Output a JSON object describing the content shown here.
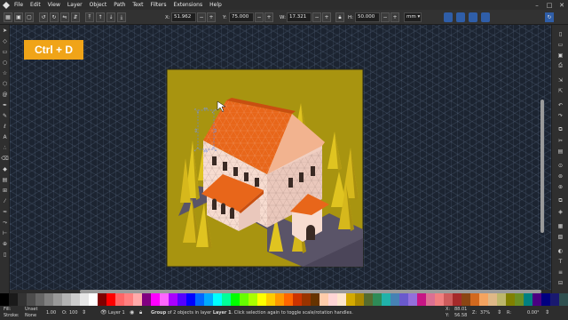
{
  "menu": [
    "File",
    "Edit",
    "View",
    "Layer",
    "Object",
    "Path",
    "Text",
    "Filters",
    "Extensions",
    "Help"
  ],
  "toolcontrols": {
    "x_label": "X:",
    "x_value": "51.962",
    "y_label": "Y:",
    "y_value": "75.000",
    "w_label": "W:",
    "w_value": "17.321",
    "h_label": "H:",
    "h_value": "50.000",
    "unit": "mm",
    "minus": "−",
    "plus": "+"
  },
  "shortcut_label": "Ctrl + D",
  "palette": [
    "#000000",
    "#1a1a1a",
    "#333333",
    "#4d4d4d",
    "#666666",
    "#808080",
    "#999999",
    "#b3b3b3",
    "#cccccc",
    "#e6e6e6",
    "#ffffff",
    "#800000",
    "#ff0000",
    "#ff6666",
    "#ff8080",
    "#ffaaaa",
    "#800080",
    "#ff00ff",
    "#ff66ff",
    "#aa00ff",
    "#5500ff",
    "#0000ff",
    "#0066ff",
    "#00aaff",
    "#00ffff",
    "#00ff99",
    "#00ff00",
    "#66ff00",
    "#aaff00",
    "#ffff00",
    "#ffcc00",
    "#ff9900",
    "#ff6600",
    "#cc3300",
    "#993300",
    "#663300",
    "#ffccaa",
    "#ffd5d5",
    "#ffe6cc",
    "#d4aa00",
    "#aa8800",
    "#556b2f",
    "#2e8b57",
    "#20b2aa",
    "#4682b4",
    "#6a5acd",
    "#9370db",
    "#c71585",
    "#db7093",
    "#f08080",
    "#cd5c5c",
    "#a52a2a",
    "#8b4513",
    "#d2691e",
    "#f4a460",
    "#deb887",
    "#bdb76b",
    "#808000",
    "#6b8e23",
    "#008080",
    "#4b0082",
    "#000080",
    "#191970",
    "#2f4f4f"
  ],
  "status": {
    "fill_label": "Fill:",
    "fill_value": "Unset",
    "stroke_label": "Stroke:",
    "stroke_value": "None",
    "stroke_width": "1.00",
    "opacity_label": "O:",
    "opacity_value": "100",
    "layer": "Layer 1",
    "message_bold": "Group",
    "message": " of 2 objects in layer ",
    "message_layer": "Layer 1",
    "message_tail": ". Click selection again to toggle scale/rotation handles.",
    "x_label": "X:",
    "x_value": "88.01",
    "y_label": "Y:",
    "y_value": "56.58",
    "z_label": "Z:",
    "z_value": "37%",
    "r_label": "R:",
    "r_value": "0.00°"
  },
  "colors": {
    "accent": "#f0a418",
    "canvas": "#1c2431",
    "artboard": "#a89410",
    "roof": "#e8661a",
    "wall": "#f7dcd0"
  }
}
